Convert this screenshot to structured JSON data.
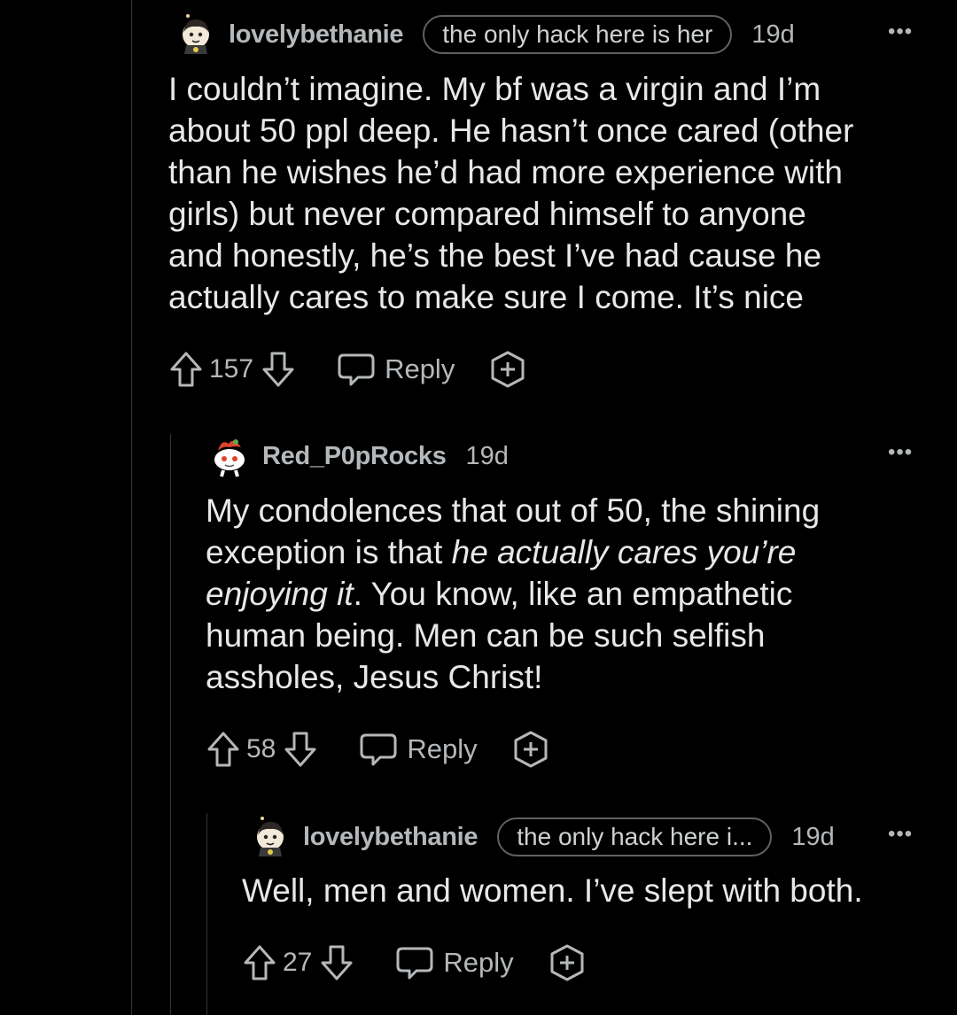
{
  "comments": [
    {
      "username": "lovelybethanie",
      "flair": "the only hack here is her",
      "time": "19d",
      "body_lines": [
        "I couldn’t imagine. My bf was a virgin and I’m",
        "about 50 ppl deep. He hasn’t once cared (other",
        "than he wishes he’d had more experience with",
        "girls) but never compared himself to anyone",
        "and honestly, he’s the best I’ve had cause he",
        "actually cares to make sure I come. It’s nice"
      ],
      "votes": "157",
      "reply_label": "Reply",
      "more_icon": "more-dots-icon"
    },
    {
      "username": "Red_P0pRocks",
      "time": "19d",
      "body_parts": [
        "My condolences that out of 50, the shining",
        "exception is that ",
        "he actually cares you’re",
        "enjoying it",
        ". You know, like an empathetic",
        "human being. Men can be such selfish",
        "assholes, Jesus Christ!"
      ],
      "votes": "58",
      "reply_label": "Reply",
      "more_icon": "more-dots-icon"
    },
    {
      "username": "lovelybethanie",
      "flair": "the only hack here i...",
      "time": "19d",
      "body_lines": [
        "Well, men and women. I’ve slept with both."
      ],
      "votes": "27",
      "reply_label": "Reply",
      "more_icon": "more-dots-icon"
    }
  ],
  "colors": {
    "background": "#000000",
    "text": "#e6e8ea",
    "meta": "#b5b8ba",
    "thread_line": "#343536"
  },
  "icons": [
    "upvote-icon",
    "downvote-icon",
    "reply-bubble-icon",
    "award-plus-icon",
    "more-dots-icon"
  ]
}
